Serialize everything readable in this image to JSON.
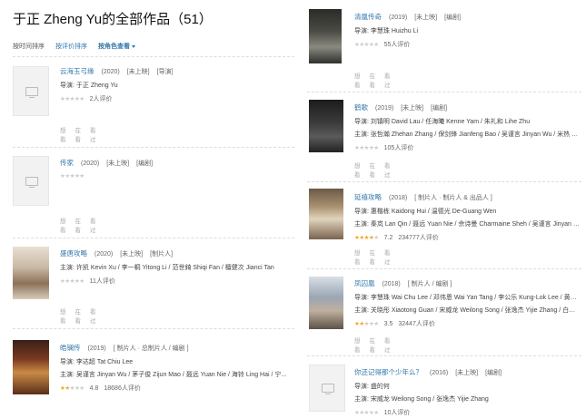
{
  "page": {
    "title": "于正 Zheng Yu的全部作品（51）"
  },
  "sort": {
    "by_time": "按时间排序",
    "by_rating": "按评价排序",
    "by_role": "按角色查看"
  },
  "actions": {
    "want": "想看",
    "doing": "在看",
    "done": "看过"
  },
  "works": [
    {
      "title": "云海玉弓缘",
      "year": "(2020)",
      "status": "[未上映]",
      "role": "[导演]",
      "line1": "导演: 于正 Zheng Yu",
      "line2": "",
      "stars": 0,
      "score": "",
      "count": "2人评价"
    },
    {
      "title": "传家",
      "year": "(2020)",
      "status": "[未上映]",
      "role": "[编剧]",
      "line1": "",
      "line2": "",
      "stars": 0,
      "score": "",
      "count": ""
    },
    {
      "title": "盛唐攻略",
      "year": "(2020)",
      "status": "[未上映]",
      "role": "[制片人]",
      "line1": "主演: 许凯 Kevin Xu / 李一桐 Yitong Li / 范世錡 Shiqi Fan / 檀健次 Jianci Tan",
      "line2": "",
      "stars": 0,
      "score": "",
      "count": "11人评价"
    },
    {
      "title": "皓镧传",
      "year": "(2019)",
      "status": "",
      "role": "[ 制片人 · 总制片人 / 编剧 ]",
      "line1": "导演: 李达超 Tat Chiu Lee",
      "line2": "主演: 吴谨言 Jinyan Wu / 茅子俊 Zijun Mao / 聂远 Yuan Nie / 海铃 Ling Hai / 宁...",
      "stars": 2.5,
      "score": "4.8",
      "count": "18686人评价"
    },
    {
      "title": "清凰传奇",
      "year": "(2019)",
      "status": "[未上映]",
      "role": "[编剧]",
      "line1": "导演: 李慧珠 Huizhu Li",
      "line2": "",
      "stars": 0,
      "score": "",
      "count": "55人评价"
    },
    {
      "title": "鹤歌",
      "year": "(2019)",
      "status": "[未上映]",
      "role": "[编剧]",
      "line1": "导演: 刘镇明 David Lau / 任海曦 Kenne Yam / 朱礼和 Lihe Zhu",
      "line2": "主演: 张哲瀚 Zhehan Zhang / 保剑锋 Jianfeng Bao / 吴谨言 Jinyan Wu / 米热 Meri...",
      "stars": 0,
      "score": "",
      "count": "105人评价"
    },
    {
      "title": "延禧攻略",
      "year": "(2018)",
      "status": "",
      "role": "[ 制片人 · 制片人 & 出品人 ]",
      "line1": "导演: 惠楷栋 Kaidong Hui / 温德光 De-Guang Wen",
      "line2": "主演: 秦岚 Lan Qin / 聂远 Yuan Nie / 佘诗曼 Charmaine Sheh / 吴谨言 Jinyan Wu ...",
      "stars": 3.5,
      "score": "7.2",
      "count": "234777人评价"
    },
    {
      "title": "凤囚凰",
      "year": "(2018)",
      "status": "",
      "role": "[ 制片人 / 编剧 ]",
      "line1": "导演: 李慧珠 Wai Chu Lee / 邓伟恩 Wai Yan Tang / 李公乐 Kung-Lok Lee / 黄斌 Bi...",
      "line2": "主演: 关晓彤 Xiaotong Guan / 宋威龙 Weilong Song / 张逸杰 Yijie Zhang / 白鹿 L...",
      "stars": 2,
      "score": "3.5",
      "count": "32447人评价"
    },
    {
      "title": "你还记得那个少年么？",
      "year": "(2016)",
      "status": "[未上映]",
      "role": "[编剧]",
      "line1": "导演: 盛的何",
      "line2": "主演: 宋威龙 Weilong Song / 张逸杰 Yijie Zhang",
      "stars": 0,
      "score": "",
      "count": "10人评价"
    }
  ]
}
